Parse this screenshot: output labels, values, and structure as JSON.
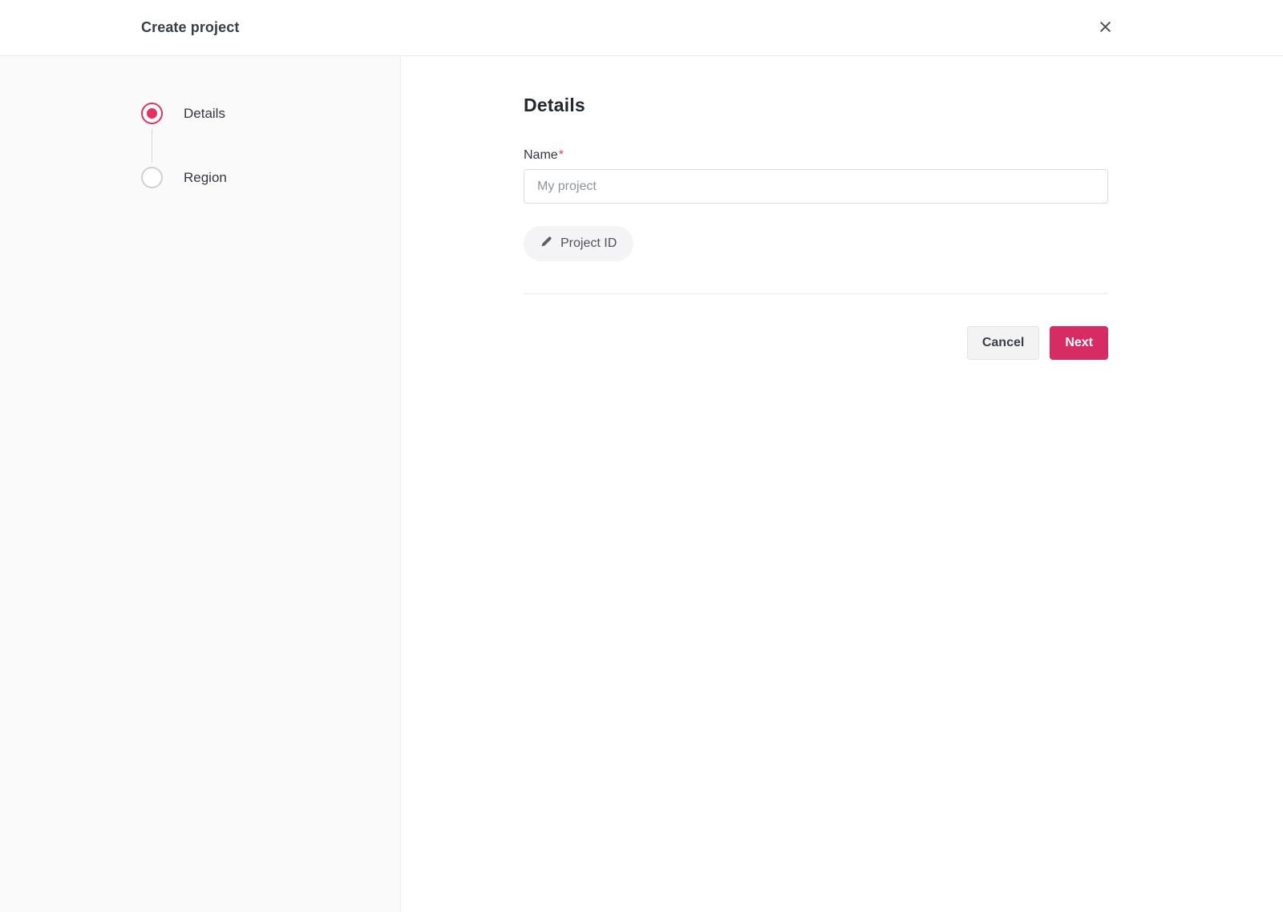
{
  "header": {
    "title": "Create project"
  },
  "stepper": {
    "steps": [
      {
        "label": "Details",
        "state": "active"
      },
      {
        "label": "Region",
        "state": "inactive"
      }
    ]
  },
  "main": {
    "section_title": "Details",
    "name_field": {
      "label": "Name",
      "required_marker": "*",
      "placeholder": "My project"
    },
    "project_id_button": {
      "label": "Project ID",
      "icon": "pencil-icon"
    },
    "actions": {
      "cancel_label": "Cancel",
      "next_label": "Next"
    }
  },
  "colors": {
    "accent": "#d62c63",
    "stepper_active": "#e8315f",
    "required_marker": "#e5484d"
  }
}
